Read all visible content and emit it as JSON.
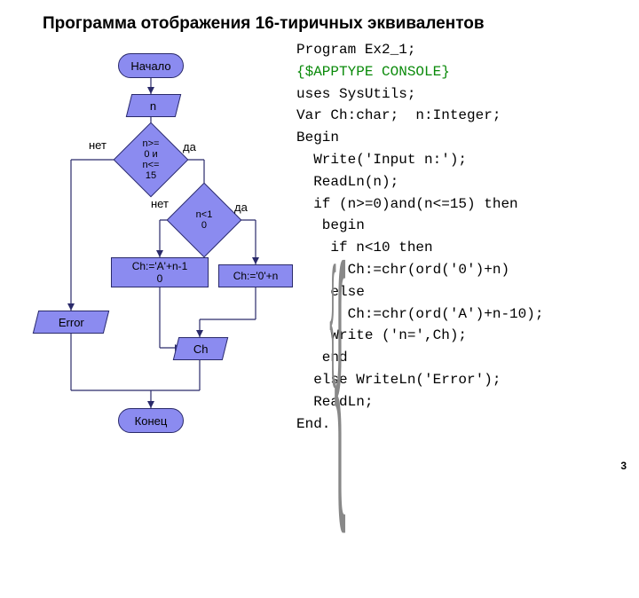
{
  "title": "Программа отображения 16-тиричных эквивалентов",
  "page_number": "3",
  "flow": {
    "start": "Начало",
    "input_n": "n",
    "cond1": "n>=\n0 и\nn<=\n15",
    "cond1_no": "нет",
    "cond1_yes": "да",
    "cond2": "n<1\n0",
    "cond2_no": "нет",
    "cond2_yes": "да",
    "assign_a": "Ch:='A'+n-1\n0",
    "assign_0": "Ch:='0'+n",
    "error": "Error",
    "out_ch": "Ch",
    "end": "Конец"
  },
  "code": {
    "l1": "Program Ex2_1;",
    "l2": "{$APPTYPE CONSOLE}",
    "l3": "uses SysUtils;",
    "l4": "Var Ch:char;  n:Integer;",
    "l5": "Begin",
    "l6": "  Write('Input n:');",
    "l7": "  ReadLn(n);",
    "l8": "  if (n>=0)and(n<=15) then",
    "l9": "   begin",
    "l10": "    if n<10 then",
    "l11": "      Ch:=chr(ord('0')+n)",
    "l12": "    else",
    "l13": "      Ch:=chr(ord('A')+n-10);",
    "l14": "    Write ('n=',Ch);",
    "l15": "   end",
    "l16": "  else WriteLn('Error');",
    "l17": "  ReadLn;",
    "l18": "End."
  }
}
